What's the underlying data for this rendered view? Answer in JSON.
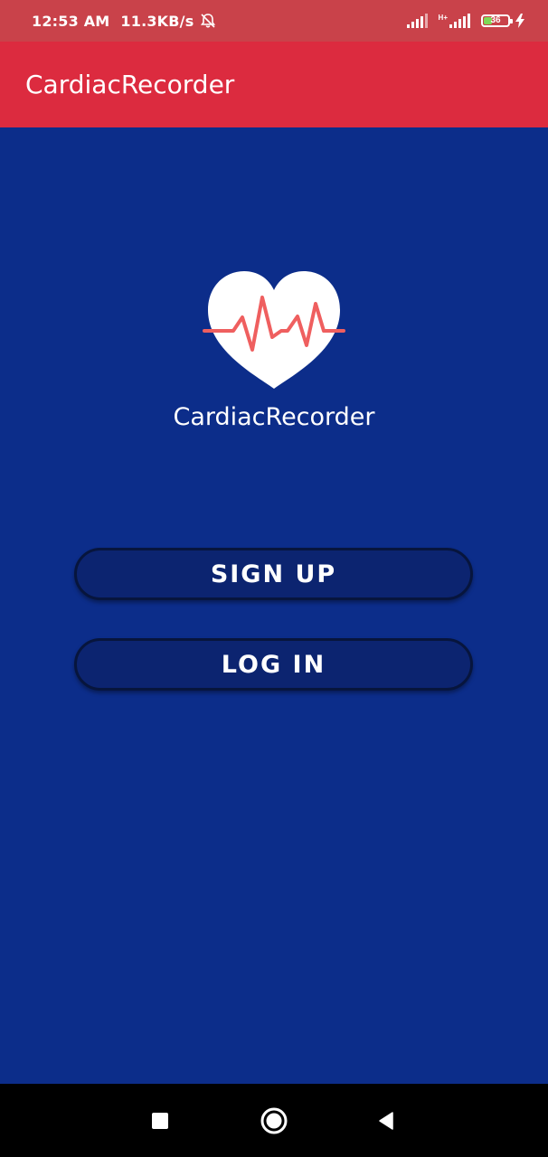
{
  "status_bar": {
    "time": "12:53 AM",
    "network_speed": "11.3KB/s",
    "muted_icon": "bell-off-icon",
    "signal_icon": "signal-bars-icon",
    "hspa_label": "H+",
    "battery_level": "36",
    "battery_fraction": 0.36,
    "charging_icon": "lightning-bolt-icon"
  },
  "app_bar": {
    "title": "CardiacRecorder"
  },
  "logo": {
    "icon": "heart-pulse-icon",
    "name": "CardiacRecorder"
  },
  "buttons": {
    "signup_label": "SIGN UP",
    "login_label": "LOG IN"
  },
  "nav_bar": {
    "recents_icon": "square-icon",
    "home_icon": "circle-icon",
    "back_icon": "triangle-back-icon"
  },
  "colors": {
    "status_bar": "#c9424a",
    "app_bar": "#dc2b3f",
    "background": "#0c2d8a",
    "button": "#0c2470",
    "heart": "#ffffff",
    "pulse": "#ef5f5f"
  }
}
